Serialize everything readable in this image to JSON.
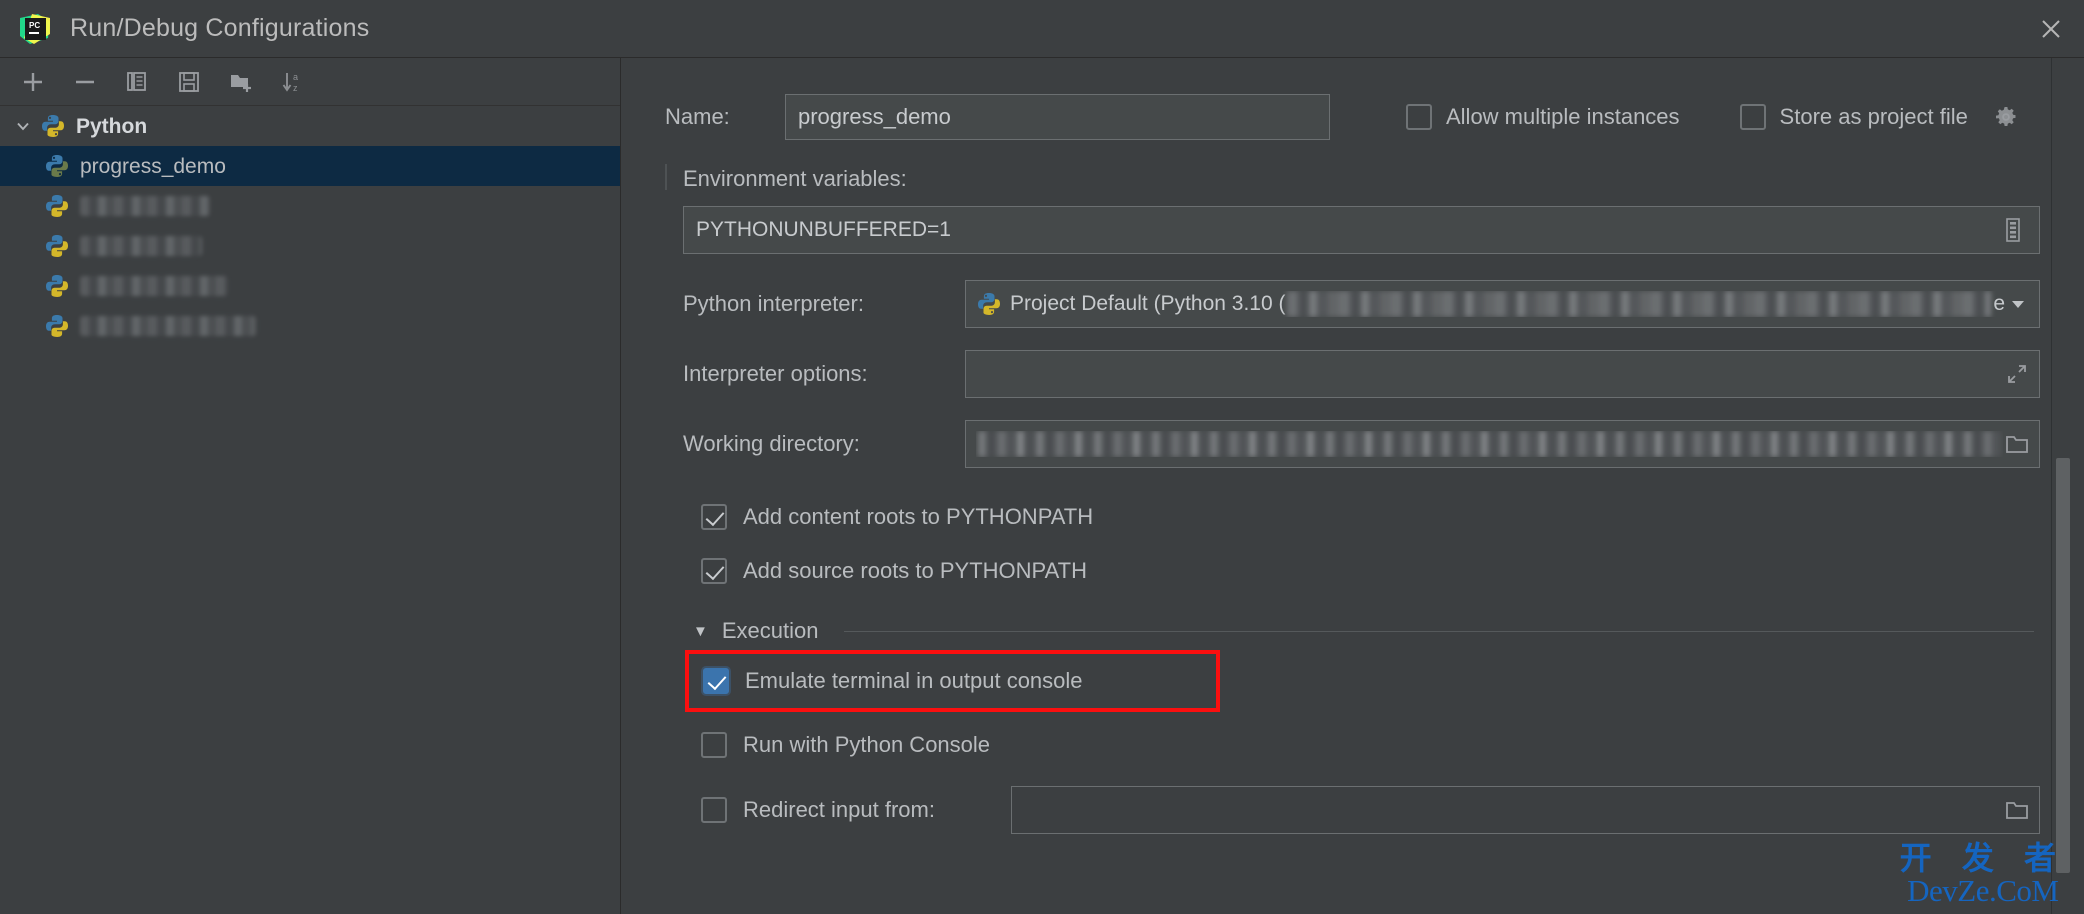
{
  "window": {
    "title": "Run/Debug Configurations",
    "app_icon": "pycharm-logo-icon",
    "close_icon": "close-icon"
  },
  "toolbar": {
    "buttons": [
      {
        "name": "add-configuration-button",
        "icon": "plus-icon"
      },
      {
        "name": "remove-configuration-button",
        "icon": "minus-icon"
      },
      {
        "name": "copy-configuration-button",
        "icon": "copy-icon"
      },
      {
        "name": "save-configuration-button",
        "icon": "save-icon"
      },
      {
        "name": "move-to-folder-button",
        "icon": "new-folder-icon"
      },
      {
        "name": "sort-configurations-button",
        "icon": "sort-az-icon"
      }
    ]
  },
  "sidebar": {
    "items": [
      {
        "label": "Python",
        "type": "group",
        "expanded": true,
        "icon": "python-icon",
        "selected": false,
        "redacted": false
      },
      {
        "label": "progress_demo",
        "type": "item",
        "icon": "python-icon",
        "selected": true,
        "redacted": false
      },
      {
        "label": "",
        "type": "item",
        "icon": "python-icon",
        "selected": false,
        "redacted": true,
        "blur_width": 130
      },
      {
        "label": "",
        "type": "item",
        "icon": "python-icon",
        "selected": false,
        "redacted": true,
        "blur_width": 122
      },
      {
        "label": "",
        "type": "item",
        "icon": "python-icon",
        "selected": false,
        "redacted": true,
        "blur_width": 148
      },
      {
        "label": "",
        "type": "item",
        "icon": "python-icon",
        "selected": false,
        "redacted": true,
        "blur_width": 176
      }
    ]
  },
  "form": {
    "name_label": "Name:",
    "name_value": "progress_demo",
    "allow_multiple_instances": {
      "label": "Allow multiple instances",
      "checked": false
    },
    "store_as_project_file": {
      "label": "Store as project file",
      "checked": false,
      "icon": "gear-icon"
    },
    "environment_variables": {
      "label": "Environment variables:",
      "value": "PYTHONUNBUFFERED=1",
      "expand_icon": "edit-list-icon"
    },
    "python_interpreter": {
      "label": "Python interpreter:",
      "value": "Project Default (Python 3.10 (",
      "value_suffix": "e",
      "icon": "python-icon",
      "caret": "▼",
      "redacted": true
    },
    "interpreter_options": {
      "label": "Interpreter options:",
      "value": "",
      "expand_icon": "expand-icon"
    },
    "working_directory": {
      "label": "Working directory:",
      "value": "",
      "browse_icon": "folder-icon",
      "redacted": true
    },
    "add_content_roots": {
      "label": "Add content roots to PYTHONPATH",
      "checked": true
    },
    "add_source_roots": {
      "label": "Add source roots to PYTHONPATH",
      "checked": true
    },
    "execution_section": {
      "label": "Execution",
      "expanded": true,
      "triangle": "▼"
    },
    "emulate_terminal": {
      "label": "Emulate terminal in output console",
      "checked": true,
      "highlighted": true,
      "highlight_color": "#fb0f0f"
    },
    "run_with_python_console": {
      "label": "Run with Python Console",
      "checked": false
    },
    "redirect_input_from": {
      "label": "Redirect input from:",
      "checked": false,
      "value": "",
      "browse_icon": "folder-icon"
    }
  },
  "watermark": {
    "line1": "开 发 者",
    "line2": "DevZe.CoM",
    "color": "#1565c0"
  },
  "colors": {
    "background": "#3c3f41",
    "field_background": "#45494a",
    "border": "#6b6f71",
    "text": "#b9bcbf",
    "selection": "#0d2a43",
    "accent": "#3b74ad",
    "highlight": "#fb0f0f"
  }
}
